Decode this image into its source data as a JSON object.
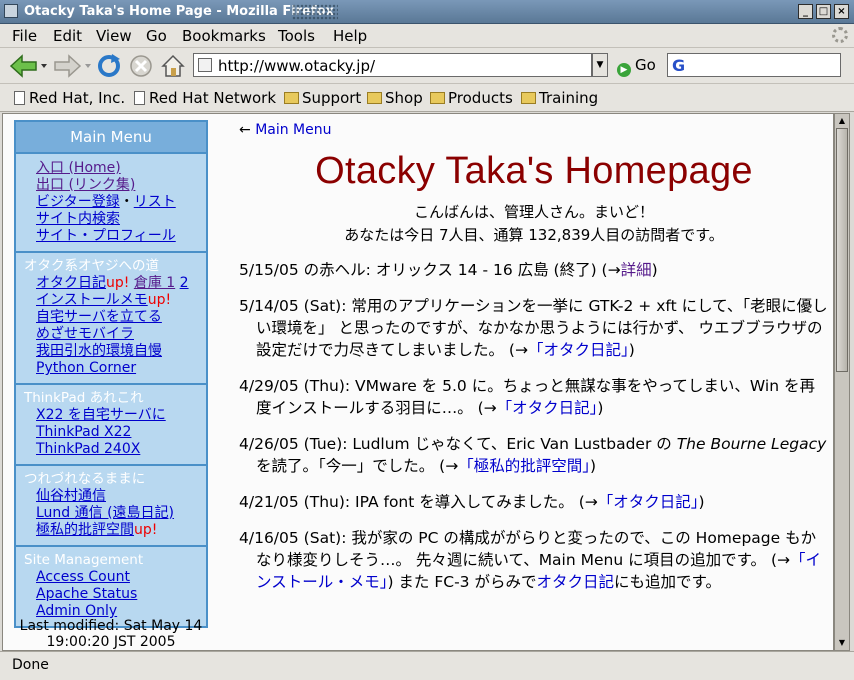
{
  "window": {
    "title": "Otacky Taka's Home Page - Mozilla Firefox"
  },
  "menubar": {
    "items": [
      "File",
      "Edit",
      "View",
      "Go",
      "Bookmarks",
      "Tools",
      "Help"
    ]
  },
  "navbar": {
    "url": "http://www.otacky.jp/",
    "go_label": "Go",
    "search_engine_letter": "G"
  },
  "bookmarks": [
    "Red Hat, Inc.",
    "Red Hat Network",
    "Support",
    "Shop",
    "Products",
    "Training"
  ],
  "sidebar": {
    "heading": "Main Menu",
    "sec1": {
      "links": [
        "入口 (Home)",
        "出口 (リンク集)",
        "ビジター登録",
        "・",
        "リスト",
        "サイト内検索",
        "サイト・プロフィール"
      ]
    },
    "sec2": {
      "caption": "オタク系オヤジへの道",
      "diary": "オタク日記",
      "up": "up!",
      "souko": "倉庫 1",
      "souko2": "2",
      "install": "インストールメモ",
      "server": "自宅サーバを立てる",
      "mobile": "めざせモバイラ",
      "env": "我田引水的環境自慢",
      "python": "Python Corner"
    },
    "sec3": {
      "caption": "ThinkPad あれこれ",
      "links": [
        "X22 を自宅サーバに",
        "ThinkPad X22",
        "ThinkPad 240X"
      ]
    },
    "sec4": {
      "caption": "つれづれなるままに",
      "links": [
        "仙谷村通信",
        "Lund 通信 (遠島日記)",
        "極私的批評空間"
      ],
      "up": "up!"
    },
    "sec5": {
      "caption": "Site Management",
      "links": [
        "Access Count",
        "Apache Status",
        "Admin Only"
      ]
    },
    "last_modified": [
      "Last modified: Sat May 14",
      "19:00:20 JST 2005"
    ]
  },
  "main": {
    "back_arrow": "←",
    "back_label": "Main Menu",
    "title": "Otacky Taka's Homepage",
    "greeting1": "こんばんは、管理人さん。まいど！",
    "greeting2": "あなたは今日 7人目、通算 132,839人目の訪問者です。",
    "news": [
      {
        "text": "5/15/05 の赤ヘル: オリックス 14 - 16 広島 (終了) (→",
        "link": "詳細",
        "after": ")"
      },
      {
        "text": "5/14/05 (Sat): 常用のアプリケーションを一挙に GTK-2 + xft にして、「老眼に優しい環境を」 と思ったのですが、なかなか思うようには行かず、 ウエブブラウザの設定だけで力尽きてしまいました。 (→",
        "link": "「オタク日記」",
        "after": ")"
      },
      {
        "text": "4/29/05 (Thu): VMware を 5.0 に。ちょっと無謀な事をやってしまい、Win を再度インストールする羽目に…。 (→",
        "link": "「オタク日記」",
        "after": ")"
      },
      {
        "text_a": "4/26/05 (Tue): Ludlum じゃなくて、Eric Van Lustbader の ",
        "italic": "The Bourne Legacy",
        "text_b": " を読了。「今一」でした。 (→",
        "link": "「極私的批評空間」",
        "after": ")"
      },
      {
        "text": "4/21/05 (Thu): IPA font を導入してみました。 (→",
        "link": "「オタク日記」",
        "after": ")"
      },
      {
        "text": "4/16/05 (Sat): 我が家の PC の構成ががらりと変ったので、この Homepage もかなり様変りしそう…。 先々週に続いて、Main Menu に項目の追加です。 (→",
        "link": "「インストール・メモ」",
        "mid": ") また FC-3 がらみで",
        "link2": "オタク日記",
        "after": "にも追加です。"
      }
    ]
  },
  "status": {
    "text": "Done"
  }
}
